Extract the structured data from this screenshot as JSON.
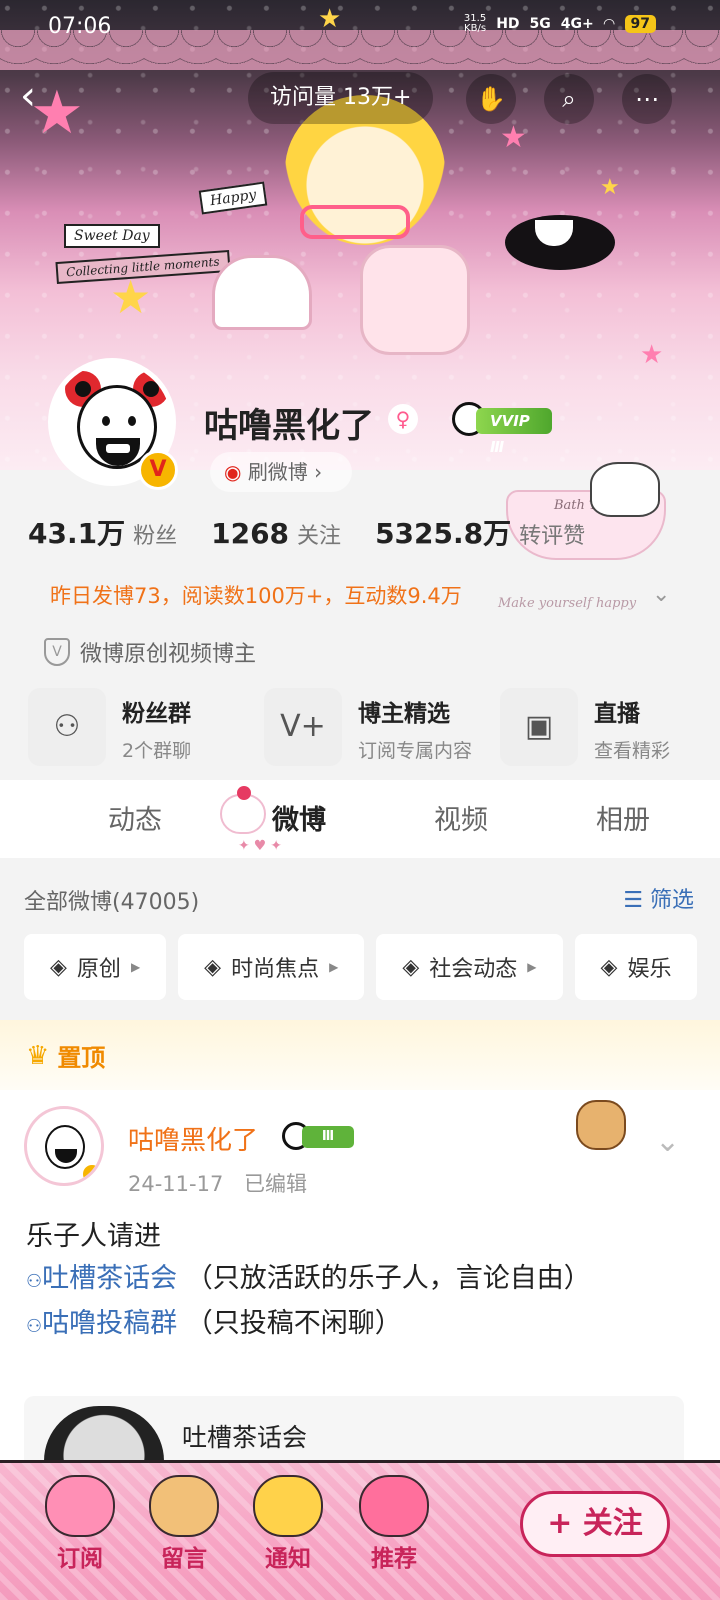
{
  "status_bar": {
    "time": "07:06",
    "net_speed": "31.5",
    "net_speed_unit": "KB/s",
    "network_a": "HD",
    "network_b": "5G",
    "network_c": "4G+",
    "battery": "97"
  },
  "nav": {
    "visits": "访问量 13万+",
    "back_icon": "back-icon",
    "compass_icon": "gesture-icon",
    "search_icon": "search-icon",
    "more_icon": "more-icon"
  },
  "profile": {
    "name": "咕噜黑化了",
    "vip_tag": "VVIP Ⅲ",
    "shua_weibo": "刷微博 ›",
    "stats": [
      {
        "num": "43.1万",
        "label": "粉丝"
      },
      {
        "num": "1268",
        "label": "关注"
      },
      {
        "num": "5325.8万",
        "label": "转评赞"
      }
    ],
    "summary": "昨日发博73，阅读数100万+，互动数9.4万",
    "creator_tag": "微博原创视频博主"
  },
  "banner_text": {
    "happy": "Happy",
    "sweet_day": "Sweet Day",
    "collecting": "Collecting little moments",
    "bath_time": "Bath Time",
    "make_happy": "Make yourself happy"
  },
  "quick_links": [
    {
      "title": "粉丝群",
      "sub": "2个群聊",
      "icon": "group-icon"
    },
    {
      "title": "博主精选",
      "sub": "订阅专属内容",
      "icon": "v-plus-icon"
    },
    {
      "title": "直播",
      "sub": "查看精彩",
      "icon": "tv-icon"
    }
  ],
  "tabs": [
    "动态",
    "微博",
    "视频",
    "相册"
  ],
  "active_tab": "微博",
  "filter": {
    "all": "全部微博(47005)",
    "filter_label": "筛选",
    "chips": [
      "原创",
      "时尚焦点",
      "社会动态",
      "娱乐"
    ]
  },
  "post": {
    "pinned": "置顶",
    "user": "咕噜黑化了",
    "vip": "Ⅲ",
    "date": "24-11-17",
    "edited": "已编辑",
    "line1": "乐子人请进",
    "group1": "吐槽茶话会",
    "group1_note": "（只放活跃的乐子人，言论自由）",
    "group2": "咕噜投稿群",
    "group2_note": "（只投稿不闲聊）",
    "card_title": "吐槽茶话会"
  },
  "bottom_bar": {
    "items": [
      "订阅",
      "留言",
      "通知",
      "推荐"
    ],
    "follow": "+ 关注"
  }
}
